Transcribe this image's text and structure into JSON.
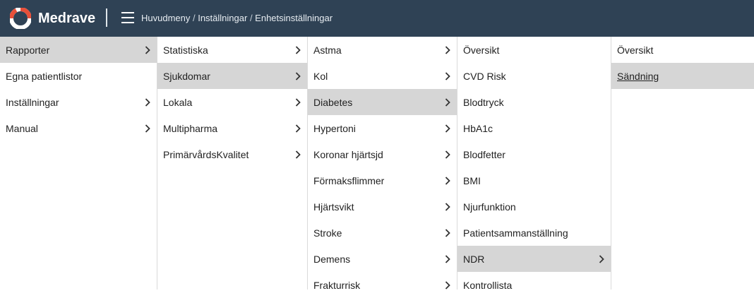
{
  "header": {
    "brand": "Medrave",
    "breadcrumb": [
      "Huvudmeny",
      "Inställningar",
      "Enhetsinställningar"
    ],
    "background": "#2f4255",
    "logo_colors": [
      "#e8503a",
      "#ffffff"
    ]
  },
  "columns": [
    {
      "items": [
        {
          "label": "Rapporter",
          "arrow": true,
          "active": true
        },
        {
          "label": "Egna patientlistor",
          "arrow": false,
          "active": false
        },
        {
          "label": "Inställningar",
          "arrow": true,
          "active": false
        },
        {
          "label": "Manual",
          "arrow": true,
          "active": false
        }
      ]
    },
    {
      "items": [
        {
          "label": "Statistiska",
          "arrow": true,
          "active": false
        },
        {
          "label": "Sjukdomar",
          "arrow": true,
          "active": true
        },
        {
          "label": "Lokala",
          "arrow": true,
          "active": false
        },
        {
          "label": "Multipharma",
          "arrow": true,
          "active": false
        },
        {
          "label": "PrimärvårdsKvalitet",
          "arrow": true,
          "active": false
        }
      ]
    },
    {
      "items": [
        {
          "label": "Astma",
          "arrow": true,
          "active": false
        },
        {
          "label": "Kol",
          "arrow": true,
          "active": false
        },
        {
          "label": "Diabetes",
          "arrow": true,
          "active": true
        },
        {
          "label": "Hypertoni",
          "arrow": true,
          "active": false
        },
        {
          "label": "Koronar hjärtsjd",
          "arrow": true,
          "active": false
        },
        {
          "label": "Förmaksflimmer",
          "arrow": true,
          "active": false
        },
        {
          "label": "Hjärtsvikt",
          "arrow": true,
          "active": false
        },
        {
          "label": "Stroke",
          "arrow": true,
          "active": false
        },
        {
          "label": "Demens",
          "arrow": true,
          "active": false
        },
        {
          "label": "Frakturrisk",
          "arrow": true,
          "active": false
        }
      ]
    },
    {
      "items": [
        {
          "label": "Översikt",
          "arrow": false,
          "active": false
        },
        {
          "label": "CVD Risk",
          "arrow": false,
          "active": false
        },
        {
          "label": "Blodtryck",
          "arrow": false,
          "active": false
        },
        {
          "label": "HbA1c",
          "arrow": false,
          "active": false
        },
        {
          "label": "Blodfetter",
          "arrow": false,
          "active": false
        },
        {
          "label": "BMI",
          "arrow": false,
          "active": false
        },
        {
          "label": "Njurfunktion",
          "arrow": false,
          "active": false
        },
        {
          "label": "Patientsammanställning",
          "arrow": false,
          "active": false
        },
        {
          "label": "NDR",
          "arrow": true,
          "active": true
        },
        {
          "label": "Kontrollista",
          "arrow": false,
          "active": false
        }
      ]
    },
    {
      "items": [
        {
          "label": "Översikt",
          "arrow": false,
          "active": false
        },
        {
          "label": "Sändning",
          "arrow": false,
          "active": true,
          "underline": true
        }
      ]
    }
  ]
}
